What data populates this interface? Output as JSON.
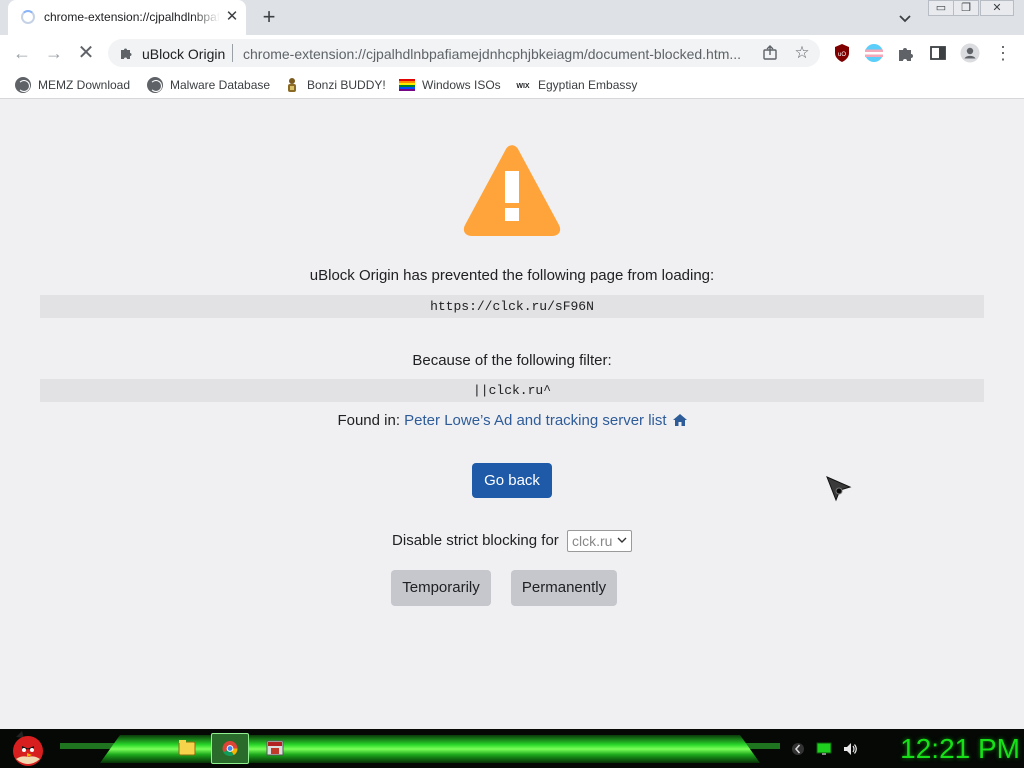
{
  "tab": {
    "title": "chrome-extension://cjpalhdlnbpafiamejdnhcphjbkeiagm/document-blocked.html",
    "close_icon": "close-icon",
    "new_tab_label": "+"
  },
  "window_controls": {
    "minimize": "▭",
    "maximize": "❐",
    "close": "✕"
  },
  "toolbar": {
    "back": "←",
    "forward": "→",
    "stop": "✕",
    "site_label": "uBlock Origin",
    "url": "chrome-extension://cjpalhdlnbpafiamejdnhcphjbkeiagm/document-blocked.htm...",
    "star": "☆",
    "menu": "⋮"
  },
  "bookmarks": [
    {
      "label": "MEMZ Download",
      "icon": "globe-icon"
    },
    {
      "label": "Malware Database",
      "icon": "globe-icon"
    },
    {
      "label": "Bonzi BUDDY!",
      "icon": "bonzi-icon"
    },
    {
      "label": "Windows ISOs",
      "icon": "rainbow-flag-icon"
    },
    {
      "label": "Egyptian Embassy",
      "icon": "wix-icon"
    }
  ],
  "page": {
    "blocked_message": "uBlock Origin has prevented the following page from loading:",
    "blocked_url": "https://clck.ru/sF96N",
    "filter_message": "Because of the following filter:",
    "filter": "||clck.ru^",
    "found_in_prefix": "Found in:",
    "found_in_list": "Peter Lowe’s Ad and tracking server list",
    "go_back": "Go back",
    "disable_prefix": "Disable strict blocking for",
    "disable_select_value": "clck.ru",
    "temporarily": "Temporarily",
    "permanently": "Permanently"
  },
  "taskbar": {
    "clock": "12:21 PM"
  },
  "colors": {
    "warning": "#ffa43a",
    "link": "#2e5c99",
    "primary_button": "#1e5aa8",
    "clock": "#18e018"
  }
}
